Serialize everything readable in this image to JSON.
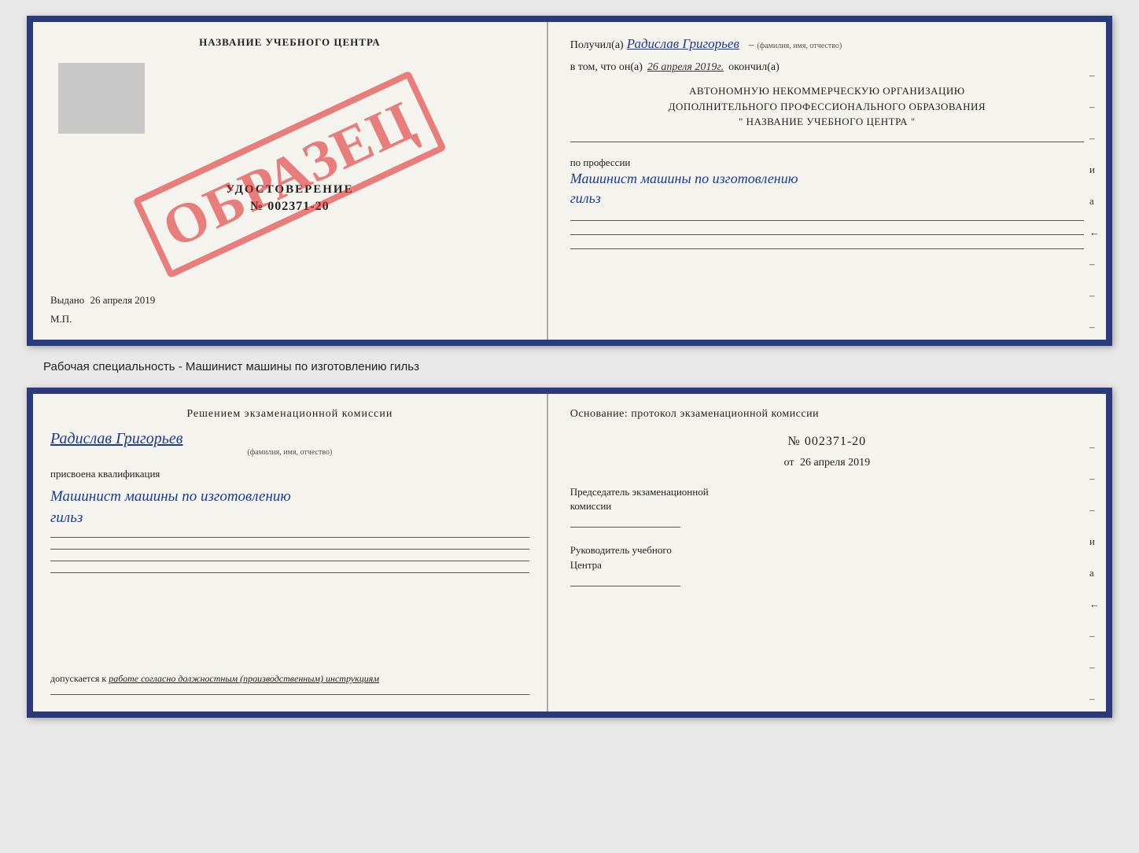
{
  "topCert": {
    "left": {
      "title": "НАЗВАНИЕ УЧЕБНОГО ЦЕНТРА",
      "grayBoxLabel": "",
      "udostoverenie": "УДОСТОВЕРЕНИЕ",
      "number": "№ 002371-20",
      "obrazets": "ОБРАЗЕЦ",
      "vydano": "Выдано",
      "vydanoDate": "26 апреля 2019",
      "mp": "М.П."
    },
    "right": {
      "poluchilPrefix": "Получил(а)",
      "personName": "Радислав Григорьев",
      "fioLabel": "(фамилия, имя, отчество)",
      "vtomPrefix": "в том, что он(а)",
      "date": "26 апреля 2019г.",
      "okonchil": "окончил(а)",
      "orgLine1": "АВТОНОМНУЮ НЕКОММЕРЧЕСКУЮ ОРГАНИЗАЦИЮ",
      "orgLine2": "ДОПОЛНИТЕЛЬНОГО ПРОФЕССИОНАЛЬНОГО ОБРАЗОВАНИЯ",
      "orgLine3": "\"  НАЗВАНИЕ УЧЕБНОГО ЦЕНТРА  \"",
      "poProf": "по профессии",
      "profName1": "Машинист машины по изготовлению",
      "profName2": "гильз",
      "dashes": [
        "-",
        "-",
        "-",
        "и",
        "а",
        "←",
        "-",
        "-",
        "-"
      ]
    }
  },
  "middleLabel": "Рабочая специальность - Машинист машины по изготовлению гильз",
  "bottomCert": {
    "left": {
      "resheniem": "Решением  экзаменационной  комиссии",
      "personName": "Радислав Григорьев",
      "fioLabel": "(фамилия, имя, отчество)",
      "prisvoena": "присвоена квалификация",
      "kvalif1": "Машинист машины по изготовлению",
      "kvalif2": "гильз",
      "dopuskaetsya": "допускается к",
      "rabota": "работе согласно должностным (производственным) инструкциям"
    },
    "right": {
      "osnovanie": "Основание: протокол экзаменационной  комиссии",
      "protocolNumber": "№  002371-20",
      "ot": "от",
      "date": "26 апреля 2019",
      "predsedatel1": "Председатель экзаменационной",
      "predsedatel2": "комиссии",
      "rukovoditel1": "Руководитель учебного",
      "rukovoditel2": "Центра",
      "dashes": [
        "-",
        "-",
        "-",
        "и",
        "а",
        "←",
        "-",
        "-",
        "-"
      ]
    }
  }
}
